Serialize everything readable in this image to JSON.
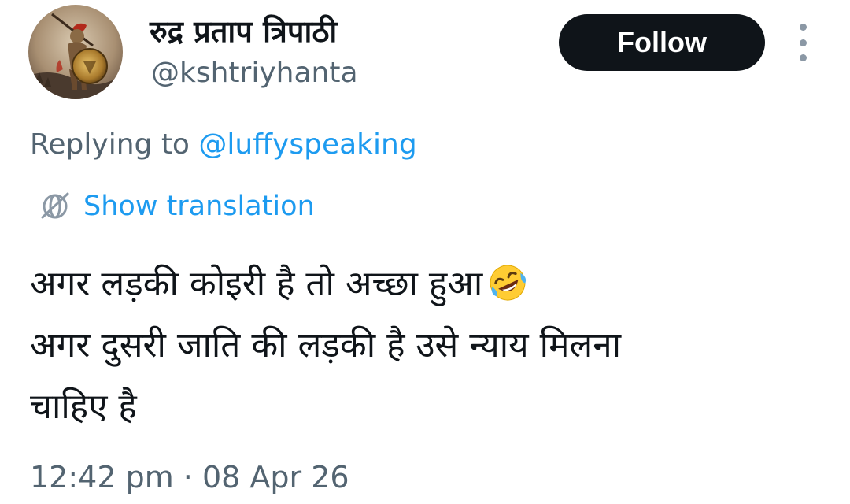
{
  "tweet": {
    "author": {
      "display_name": "रुद्र प्रताप त्रिपाठी",
      "handle": "@kshtriyhanta",
      "avatar_icon": "spartan-warrior-avatar"
    },
    "follow_label": "Follow",
    "more_icon": "more-vertical-icon",
    "replying_prefix": "Replying to",
    "replying_to": "@luffyspeaking",
    "translate_icon": "globe-icon",
    "translate_label": "Show translation",
    "text_lines": [
      "अगर लड़की कोइरी है तो अच्छा हुआ",
      "अगर दुसरी जाति की लड़की है उसे न्याय मिलना",
      "चाहिए है"
    ],
    "emoji": "rolling-on-the-floor-laughing-emoji",
    "timestamp": "12:42 pm · 08 Apr 26"
  },
  "colors": {
    "text_primary": "#0f1419",
    "text_secondary": "#536471",
    "link": "#1d9bf0",
    "button_bg": "#0f1419"
  }
}
